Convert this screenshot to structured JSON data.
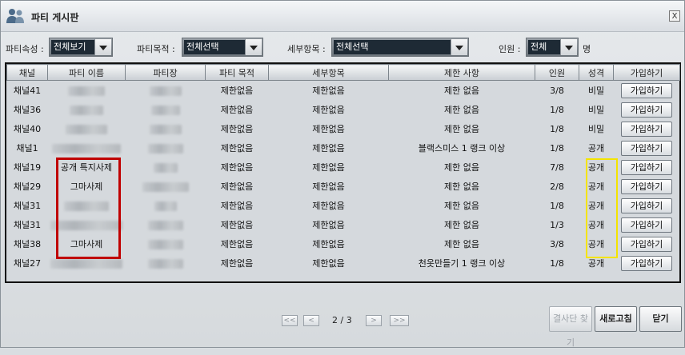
{
  "window": {
    "title": "파티 게시판",
    "close_label": "X"
  },
  "filters": [
    {
      "label": "파티속성 :",
      "value": "전체보기"
    },
    {
      "label": "파티목적 :",
      "value": "전체선택"
    },
    {
      "label": "세부항목 :",
      "value": "전체선택"
    },
    {
      "label": "인원 :",
      "value": "전체"
    }
  ],
  "filter_suffix": "명",
  "table": {
    "headers": [
      "채널",
      "파티 이름",
      "파티장",
      "파티 목적",
      "세부항목",
      "제한 사항",
      "인원",
      "성격",
      "가입하기"
    ],
    "rows": [
      {
        "channel": "채널41",
        "name": "",
        "leader": "",
        "purpose": "제한없음",
        "detail": "제한없음",
        "limit": "제한 없음",
        "members": "3/8",
        "type": "비밀",
        "join": "가입하기"
      },
      {
        "channel": "채널36",
        "name": "",
        "leader": "",
        "purpose": "제한없음",
        "detail": "제한없음",
        "limit": "제한 없음",
        "members": "1/8",
        "type": "비밀",
        "join": "가입하기"
      },
      {
        "channel": "채널40",
        "name": "",
        "leader": "",
        "purpose": "제한없음",
        "detail": "제한없음",
        "limit": "제한 없음",
        "members": "1/8",
        "type": "비밀",
        "join": "가입하기"
      },
      {
        "channel": "채널1",
        "name": "",
        "leader": "",
        "purpose": "제한없음",
        "detail": "제한없음",
        "limit": "블랙스미스 1 랭크 이상",
        "members": "1/8",
        "type": "공개",
        "join": "가입하기"
      },
      {
        "channel": "채널19",
        "name": "공개 특지사제",
        "leader": "",
        "purpose": "제한없음",
        "detail": "제한없음",
        "limit": "제한 없음",
        "members": "7/8",
        "type": "공개",
        "join": "가입하기"
      },
      {
        "channel": "채널29",
        "name": "그마사제",
        "leader": "",
        "purpose": "제한없음",
        "detail": "제한없음",
        "limit": "제한 없음",
        "members": "2/8",
        "type": "공개",
        "join": "가입하기"
      },
      {
        "channel": "채널31",
        "name": "",
        "leader": "",
        "purpose": "제한없음",
        "detail": "제한없음",
        "limit": "제한 없음",
        "members": "1/8",
        "type": "공개",
        "join": "가입하기"
      },
      {
        "channel": "채널31",
        "name": "",
        "leader": "",
        "purpose": "제한없음",
        "detail": "제한없음",
        "limit": "제한 없음",
        "members": "1/3",
        "type": "공개",
        "join": "가입하기"
      },
      {
        "channel": "채널38",
        "name": "그마사제",
        "leader": "",
        "purpose": "제한없음",
        "detail": "제한없음",
        "limit": "제한 없음",
        "members": "3/8",
        "type": "공개",
        "join": "가입하기"
      },
      {
        "channel": "채널27",
        "name": "",
        "leader": "",
        "purpose": "제한없음",
        "detail": "제한없음",
        "limit": "천옷만들기 1 랭크 이상",
        "members": "1/8",
        "type": "공개",
        "join": "가입하기"
      }
    ]
  },
  "pagination": {
    "first": "<<",
    "prev": "<",
    "current": "2 / 3",
    "next": ">",
    "last": ">>"
  },
  "actions": {
    "find": "결사단 찾기",
    "refresh": "새로고침",
    "close": "닫기"
  },
  "colors": {
    "red_highlight": "#c00000",
    "yellow_highlight": "#f4e400"
  }
}
